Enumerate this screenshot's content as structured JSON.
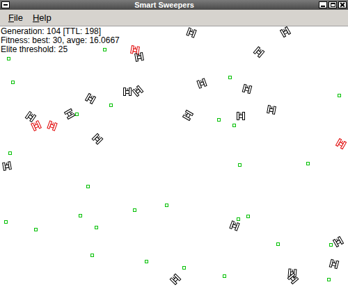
{
  "window": {
    "title": "Smart Sweepers"
  },
  "menu": [
    {
      "label": "File"
    },
    {
      "label": "Help"
    }
  ],
  "stats": [
    "Generation: 104 [TTL: 198]",
    "Fitness: best: 30, avge: 16.0667",
    "Elite threshold: 25"
  ],
  "sweepers": [
    {
      "elite": false
    },
    {
      "elite": false
    },
    {
      "elite": true
    },
    {
      "elite": false
    },
    {
      "elite": false
    },
    {
      "elite": false
    },
    {
      "elite": false
    },
    {
      "elite": false
    },
    {
      "elite": false
    },
    {
      "elite": false
    },
    {
      "elite": false
    },
    {
      "elite": true
    },
    {
      "elite": true
    },
    {
      "elite": false
    },
    {
      "elite": false
    },
    {
      "elite": false
    },
    {
      "elite": false
    },
    {
      "elite": false
    },
    {
      "elite": true
    },
    {
      "elite": false
    },
    {
      "elite": false
    },
    {
      "elite": false
    },
    {
      "elite": false
    },
    {
      "elite": false
    },
    {
      "elite": false
    },
    {
      "elite": false
    }
  ]
}
